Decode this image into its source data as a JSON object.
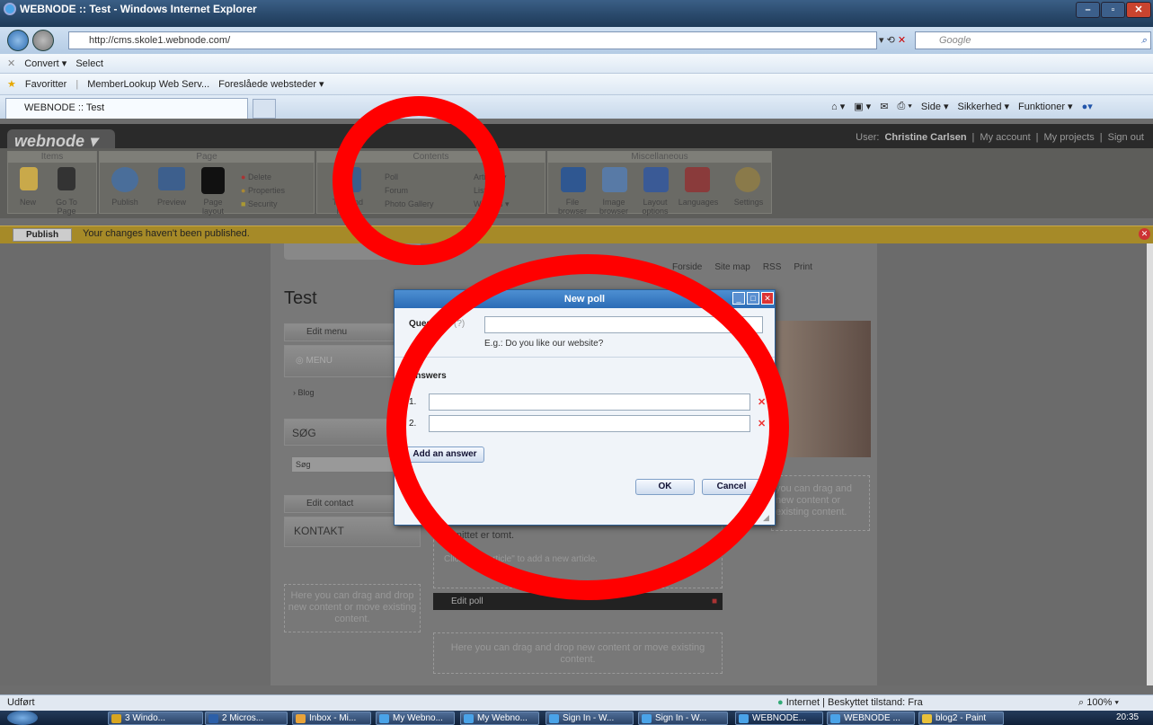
{
  "window": {
    "title": "WEBNODE :: Test - Windows Internet Explorer"
  },
  "address": {
    "url": "http://cms.skole1.webnode.com/",
    "search_placeholder": "Google"
  },
  "cmdbar": {
    "convert": "Convert ▾",
    "select": "Select"
  },
  "favbar": {
    "favorites": "Favoritter",
    "item1": "MemberLookup Web Serv...",
    "item2": "Foreslåede websteder ▾"
  },
  "tab": {
    "label": "WEBNODE :: Test"
  },
  "ie_tools": {
    "side": "Side ▾",
    "sikkerhed": "Sikkerhed ▾",
    "funktioner": "Funktioner ▾"
  },
  "app": {
    "logo": "webnode",
    "user_label": "User:",
    "user_name": "Christine Carlsen",
    "links": [
      "My account",
      "My projects",
      "Sign out"
    ]
  },
  "ribbon": {
    "groups": [
      "Items",
      "Page",
      "Contents",
      "Miscellaneous"
    ],
    "items": {
      "new": "New",
      "goto": "Go To Page",
      "publish": "Publish",
      "preview": "Preview",
      "layout": "Page layout",
      "delete": "Delete",
      "properties": "Properties",
      "security": "Security"
    },
    "contents": {
      "text": "Text and Image",
      "poll": "Poll",
      "forum": "Forum",
      "gallery": "Photo Gallery",
      "articles": "Articles ▾",
      "lists": "Lists ▾",
      "widgets": "Widgets ▾"
    },
    "misc": {
      "file": "File browser",
      "image": "Image browser",
      "layout_opt": "Layout options",
      "languages": "Languages",
      "settings": "Settings"
    }
  },
  "publishbar": {
    "button": "Publish",
    "message": "Your changes haven't been published."
  },
  "site": {
    "toplinks": [
      "Forside",
      "Site map",
      "RSS",
      "Print"
    ],
    "title": "Test",
    "edit_menu": "Edit menu",
    "menu": "MENU",
    "blog": "Blog",
    "sog_title": "SØG",
    "sog_input": "Søg",
    "edit_contact": "Edit contact",
    "kontakt": "KONTAKT",
    "drop_text": "Here you can drag and drop new content or move existing content.",
    "section_empty": "Afsnittet er tomt.",
    "add_article_hint": "Click \"Add article\" to add a new article.",
    "edit_poll": "Edit poll",
    "right_drop": "you can drag and new content or existing content."
  },
  "dialog": {
    "title": "New poll",
    "question_label": "Question",
    "question_req": "* (?)",
    "question_hint": "E.g.: Do you like our website?",
    "answers_label": "Answers",
    "answer_nums": [
      "1.",
      "2."
    ],
    "add_answer": "Add an answer",
    "ok": "OK",
    "cancel": "Cancel"
  },
  "status": {
    "left": "Udført",
    "zone": "Internet | Beskyttet tilstand: Fra",
    "zoom": "100%"
  },
  "taskbar": {
    "items": [
      "3 Windo...",
      "2 Micros...",
      "Inbox - Mi...",
      "My Webno...",
      "My Webno...",
      "Sign In - W...",
      "Sign In - W...",
      "WEBNODE...",
      "WEBNODE ...",
      "blog2 - Paint"
    ],
    "clock": "20:35"
  },
  "colors": {
    "annotation_ring": "#ff0000",
    "dialog_title": "#2b6cb6",
    "publish_bar": "#a68a28"
  }
}
